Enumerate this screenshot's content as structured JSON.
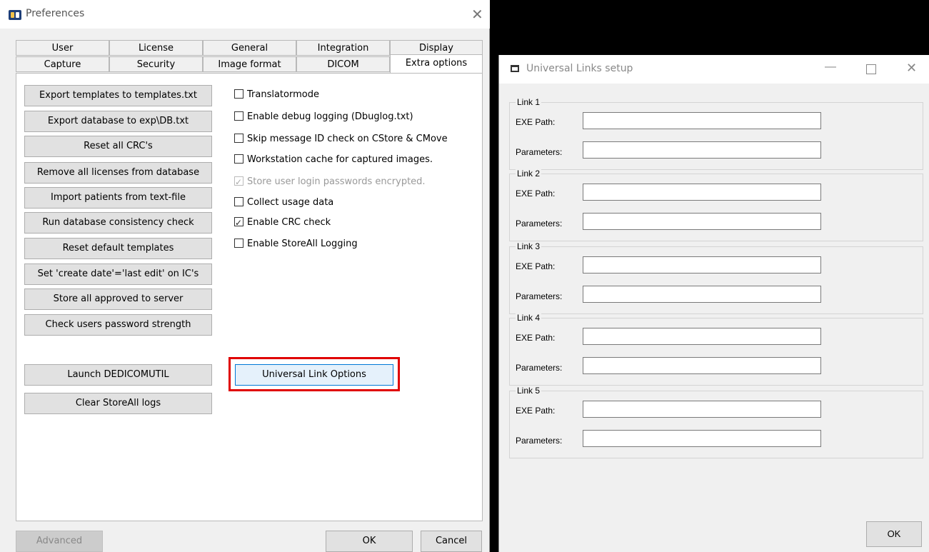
{
  "preferences": {
    "title": "Preferences",
    "close_glyph": "✕",
    "tabs_row1": [
      "User",
      "License",
      "General",
      "Integration",
      "Display"
    ],
    "tabs_row2": [
      "Capture",
      "Security",
      "Image format",
      "DICOM",
      "Extra options"
    ],
    "active_tab": "Extra options",
    "buttons": [
      "Export templates to templates.txt",
      "Export database to exp\\DB.txt",
      "Reset all CRC's",
      "Remove all licenses from database",
      "Import patients from text-file",
      "Run database consistency check",
      "Reset default templates",
      "Set 'create date'='last edit' on IC's",
      "Store all approved to server",
      "Check users password strength",
      "Launch DEDICOMUTIL",
      "Clear StoreAll logs"
    ],
    "checkboxes": [
      {
        "label": "Translatormode",
        "checked": false,
        "disabled": false
      },
      {
        "label": "Enable debug logging (Dbuglog.txt)",
        "checked": false,
        "disabled": false
      },
      {
        "label": "Skip message ID check on CStore & CMove",
        "checked": false,
        "disabled": false
      },
      {
        "label": "Workstation cache for captured images.",
        "checked": false,
        "disabled": false
      },
      {
        "label": "Store user login passwords encrypted.",
        "checked": true,
        "disabled": true
      },
      {
        "label": "Collect usage data",
        "checked": false,
        "disabled": false
      },
      {
        "label": "Enable CRC check",
        "checked": true,
        "disabled": false
      },
      {
        "label": "Enable StoreAll Logging",
        "checked": false,
        "disabled": false
      }
    ],
    "universal_link_button": "Universal Link Options",
    "advanced_button": "Advanced",
    "ok_button": "OK",
    "cancel_button": "Cancel"
  },
  "universal_links": {
    "title": "Universal Links setup",
    "minimize_glyph": "—",
    "close_glyph": "✕",
    "groups": [
      {
        "label": "Link 1",
        "exe_label": "EXE Path:",
        "exe_value": "",
        "params_label": "Parameters:",
        "params_value": ""
      },
      {
        "label": "Link 2",
        "exe_label": "EXE Path:",
        "exe_value": "",
        "params_label": "Parameters:",
        "params_value": ""
      },
      {
        "label": "Link 3",
        "exe_label": "EXE Path:",
        "exe_value": "",
        "params_label": "Parameters:",
        "params_value": ""
      },
      {
        "label": "Link 4",
        "exe_label": "EXE Path:",
        "exe_value": "",
        "params_label": "Parameters:",
        "params_value": ""
      },
      {
        "label": "Link 5",
        "exe_label": "EXE Path:",
        "exe_value": "",
        "params_label": "Parameters:",
        "params_value": ""
      }
    ],
    "ok_button": "OK"
  }
}
